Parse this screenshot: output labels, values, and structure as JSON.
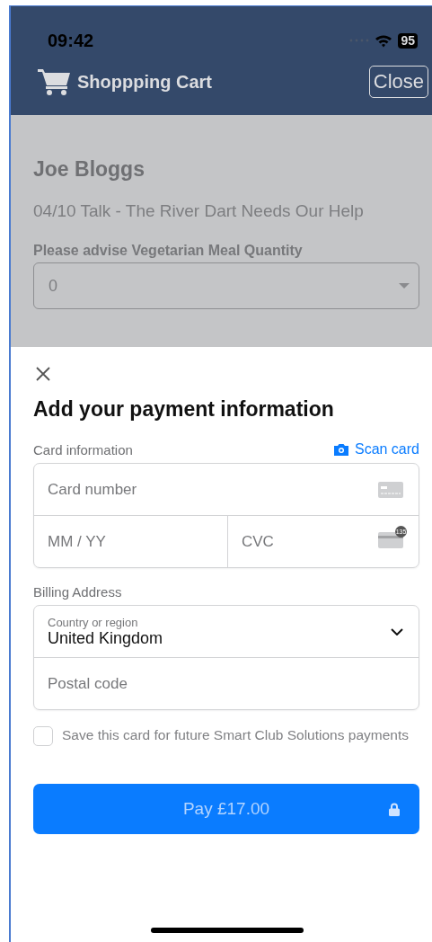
{
  "status_bar": {
    "time": "09:42",
    "battery": "95"
  },
  "header": {
    "title": "Shoppping Cart",
    "close_button": "Close"
  },
  "cart": {
    "name": "Joe Bloggs",
    "event": "04/10 Talk - The River Dart Needs Our Help",
    "meal_label": "Please advise Vegetarian Meal Quantity",
    "meal_value": "0"
  },
  "payment_sheet": {
    "title": "Add your payment information",
    "card_label": "Card information",
    "scan_card": "Scan card",
    "card_number": {
      "placeholder": "Card number"
    },
    "expiry": {
      "placeholder": "MM / YY"
    },
    "cvc": {
      "placeholder": "CVC"
    },
    "cvc_badge": "135",
    "billing_label": "Billing Address",
    "country": {
      "label": "Country or region",
      "value": "United Kingdom"
    },
    "postal_code": {
      "placeholder": "Postal code"
    },
    "save_card": {
      "label": "Save this card for future Smart Club Solutions payments",
      "checked": false
    },
    "pay_button": {
      "label": "Pay £17.00",
      "disabled": true
    }
  }
}
